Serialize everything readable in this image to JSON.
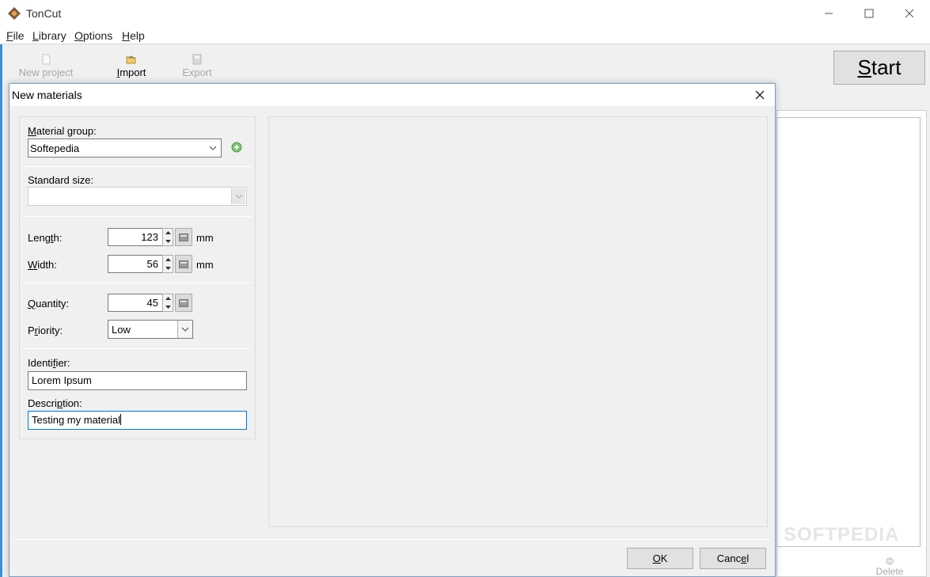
{
  "app": {
    "title": "TonCut"
  },
  "menu": {
    "items": [
      {
        "label": "File",
        "key": "F",
        "rest": "ile"
      },
      {
        "label": "Library",
        "key": "L",
        "rest": "ibrary"
      },
      {
        "label": "Options",
        "key": "O",
        "rest": "ptions"
      },
      {
        "label": "Help",
        "key": "H",
        "rest": "elp"
      }
    ]
  },
  "toolbar": {
    "new_project": "New project",
    "import_key": "I",
    "import_rest": "mport",
    "export": "Export",
    "start_key": "S",
    "start_rest": "tart"
  },
  "background": {
    "watermark": "SOFTPEDIA",
    "delete_label": "Delete"
  },
  "dialog": {
    "title": "New materials",
    "material_group_key": "M",
    "material_group_rest": "aterial group:",
    "material_group_value": "Softepedia",
    "standard_size_label": "Standard size:",
    "standard_size_value": "",
    "length_pre": "Leng",
    "length_key": "t",
    "length_post": "h:",
    "length_value": "123",
    "length_unit": "mm",
    "width_key": "W",
    "width_rest": "idth:",
    "width_value": "56",
    "width_unit": "mm",
    "quantity_key": "Q",
    "quantity_rest": "uantity:",
    "quantity_value": "45",
    "priority_pre": "P",
    "priority_key": "r",
    "priority_post": "iority:",
    "priority_value": "Low",
    "identifier_pre": "Identi",
    "identifier_key": "f",
    "identifier_post": "ier:",
    "identifier_value": "Lorem Ipsum",
    "description_pre": "Descri",
    "description_key": "p",
    "description_post": "tion:",
    "description_value": "Testing my material",
    "ok_key": "O",
    "ok_rest": "K",
    "cancel_pre": "Canc",
    "cancel_key": "e",
    "cancel_post": "l"
  },
  "colors": {
    "accent": "#0078d7",
    "add_icon": "#5cb85c"
  }
}
